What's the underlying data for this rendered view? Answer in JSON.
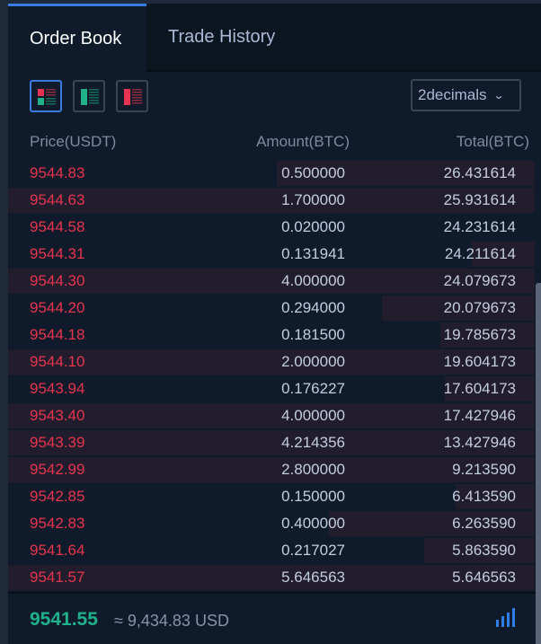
{
  "tabs": [
    {
      "label": "Order Book",
      "active": true
    },
    {
      "label": "Trade History",
      "active": false
    }
  ],
  "view_modes": [
    {
      "name": "both-sides",
      "active": true
    },
    {
      "name": "bids-only",
      "active": false
    },
    {
      "name": "asks-only",
      "active": false
    }
  ],
  "decimals": {
    "selected": "2decimals",
    "chevron": "⌄"
  },
  "headers": {
    "price": "Price(USDT)",
    "amount": "Amount(BTC)",
    "total": "Total(BTC)"
  },
  "asks": [
    {
      "price": "9544.83",
      "amount": "0.500000",
      "total": "26.431614",
      "depth": 0.49
    },
    {
      "price": "9544.63",
      "amount": "1.700000",
      "total": "25.931614",
      "depth": 1.0
    },
    {
      "price": "9544.58",
      "amount": "0.020000",
      "total": "24.231614",
      "depth": 0.0
    },
    {
      "price": "9544.31",
      "amount": "0.131941",
      "total": "24.211614",
      "depth": 0.12
    },
    {
      "price": "9544.30",
      "amount": "4.000000",
      "total": "24.079673",
      "depth": 1.0
    },
    {
      "price": "9544.20",
      "amount": "0.294000",
      "total": "20.079673",
      "depth": 0.29
    },
    {
      "price": "9544.18",
      "amount": "0.181500",
      "total": "19.785673",
      "depth": 0.18
    },
    {
      "price": "9544.10",
      "amount": "2.000000",
      "total": "19.604173",
      "depth": 1.0
    },
    {
      "price": "9543.94",
      "amount": "0.176227",
      "total": "17.604173",
      "depth": 0.17
    },
    {
      "price": "9543.40",
      "amount": "4.000000",
      "total": "17.427946",
      "depth": 1.0
    },
    {
      "price": "9543.39",
      "amount": "4.214356",
      "total": "13.427946",
      "depth": 1.0
    },
    {
      "price": "9542.99",
      "amount": "2.800000",
      "total": "9.213590",
      "depth": 1.0
    },
    {
      "price": "9542.85",
      "amount": "0.150000",
      "total": "6.413590",
      "depth": 0.15
    },
    {
      "price": "9542.83",
      "amount": "0.400000",
      "total": "6.263590",
      "depth": 0.39
    },
    {
      "price": "9541.64",
      "amount": "0.217027",
      "total": "5.863590",
      "depth": 0.21
    },
    {
      "price": "9541.57",
      "amount": "5.646563",
      "total": "5.646563",
      "depth": 1.0
    }
  ],
  "footer": {
    "last_price": "9541.55",
    "approx_usd": "≈ 9,434.83 USD"
  },
  "colors": {
    "ask": "#e8344f",
    "bid": "#1fb18a",
    "accent": "#3a7be0"
  }
}
